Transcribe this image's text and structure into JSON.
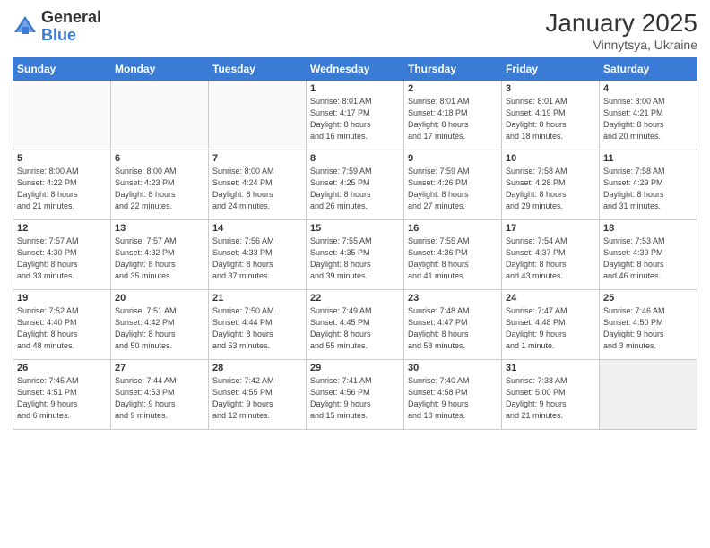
{
  "header": {
    "logo_general": "General",
    "logo_blue": "Blue",
    "month_year": "January 2025",
    "location": "Vinnytsya, Ukraine"
  },
  "days_of_week": [
    "Sunday",
    "Monday",
    "Tuesday",
    "Wednesday",
    "Thursday",
    "Friday",
    "Saturday"
  ],
  "weeks": [
    [
      {
        "num": "",
        "info": "",
        "empty": true
      },
      {
        "num": "",
        "info": "",
        "empty": true
      },
      {
        "num": "",
        "info": "",
        "empty": true
      },
      {
        "num": "1",
        "info": "Sunrise: 8:01 AM\nSunset: 4:17 PM\nDaylight: 8 hours\nand 16 minutes."
      },
      {
        "num": "2",
        "info": "Sunrise: 8:01 AM\nSunset: 4:18 PM\nDaylight: 8 hours\nand 17 minutes."
      },
      {
        "num": "3",
        "info": "Sunrise: 8:01 AM\nSunset: 4:19 PM\nDaylight: 8 hours\nand 18 minutes."
      },
      {
        "num": "4",
        "info": "Sunrise: 8:00 AM\nSunset: 4:21 PM\nDaylight: 8 hours\nand 20 minutes."
      }
    ],
    [
      {
        "num": "5",
        "info": "Sunrise: 8:00 AM\nSunset: 4:22 PM\nDaylight: 8 hours\nand 21 minutes."
      },
      {
        "num": "6",
        "info": "Sunrise: 8:00 AM\nSunset: 4:23 PM\nDaylight: 8 hours\nand 22 minutes."
      },
      {
        "num": "7",
        "info": "Sunrise: 8:00 AM\nSunset: 4:24 PM\nDaylight: 8 hours\nand 24 minutes."
      },
      {
        "num": "8",
        "info": "Sunrise: 7:59 AM\nSunset: 4:25 PM\nDaylight: 8 hours\nand 26 minutes."
      },
      {
        "num": "9",
        "info": "Sunrise: 7:59 AM\nSunset: 4:26 PM\nDaylight: 8 hours\nand 27 minutes."
      },
      {
        "num": "10",
        "info": "Sunrise: 7:58 AM\nSunset: 4:28 PM\nDaylight: 8 hours\nand 29 minutes."
      },
      {
        "num": "11",
        "info": "Sunrise: 7:58 AM\nSunset: 4:29 PM\nDaylight: 8 hours\nand 31 minutes."
      }
    ],
    [
      {
        "num": "12",
        "info": "Sunrise: 7:57 AM\nSunset: 4:30 PM\nDaylight: 8 hours\nand 33 minutes."
      },
      {
        "num": "13",
        "info": "Sunrise: 7:57 AM\nSunset: 4:32 PM\nDaylight: 8 hours\nand 35 minutes."
      },
      {
        "num": "14",
        "info": "Sunrise: 7:56 AM\nSunset: 4:33 PM\nDaylight: 8 hours\nand 37 minutes."
      },
      {
        "num": "15",
        "info": "Sunrise: 7:55 AM\nSunset: 4:35 PM\nDaylight: 8 hours\nand 39 minutes."
      },
      {
        "num": "16",
        "info": "Sunrise: 7:55 AM\nSunset: 4:36 PM\nDaylight: 8 hours\nand 41 minutes."
      },
      {
        "num": "17",
        "info": "Sunrise: 7:54 AM\nSunset: 4:37 PM\nDaylight: 8 hours\nand 43 minutes."
      },
      {
        "num": "18",
        "info": "Sunrise: 7:53 AM\nSunset: 4:39 PM\nDaylight: 8 hours\nand 46 minutes."
      }
    ],
    [
      {
        "num": "19",
        "info": "Sunrise: 7:52 AM\nSunset: 4:40 PM\nDaylight: 8 hours\nand 48 minutes."
      },
      {
        "num": "20",
        "info": "Sunrise: 7:51 AM\nSunset: 4:42 PM\nDaylight: 8 hours\nand 50 minutes."
      },
      {
        "num": "21",
        "info": "Sunrise: 7:50 AM\nSunset: 4:44 PM\nDaylight: 8 hours\nand 53 minutes."
      },
      {
        "num": "22",
        "info": "Sunrise: 7:49 AM\nSunset: 4:45 PM\nDaylight: 8 hours\nand 55 minutes."
      },
      {
        "num": "23",
        "info": "Sunrise: 7:48 AM\nSunset: 4:47 PM\nDaylight: 8 hours\nand 58 minutes."
      },
      {
        "num": "24",
        "info": "Sunrise: 7:47 AM\nSunset: 4:48 PM\nDaylight: 9 hours\nand 1 minute."
      },
      {
        "num": "25",
        "info": "Sunrise: 7:46 AM\nSunset: 4:50 PM\nDaylight: 9 hours\nand 3 minutes."
      }
    ],
    [
      {
        "num": "26",
        "info": "Sunrise: 7:45 AM\nSunset: 4:51 PM\nDaylight: 9 hours\nand 6 minutes."
      },
      {
        "num": "27",
        "info": "Sunrise: 7:44 AM\nSunset: 4:53 PM\nDaylight: 9 hours\nand 9 minutes."
      },
      {
        "num": "28",
        "info": "Sunrise: 7:42 AM\nSunset: 4:55 PM\nDaylight: 9 hours\nand 12 minutes."
      },
      {
        "num": "29",
        "info": "Sunrise: 7:41 AM\nSunset: 4:56 PM\nDaylight: 9 hours\nand 15 minutes."
      },
      {
        "num": "30",
        "info": "Sunrise: 7:40 AM\nSunset: 4:58 PM\nDaylight: 9 hours\nand 18 minutes."
      },
      {
        "num": "31",
        "info": "Sunrise: 7:38 AM\nSunset: 5:00 PM\nDaylight: 9 hours\nand 21 minutes."
      },
      {
        "num": "",
        "info": "",
        "empty": true
      }
    ]
  ]
}
